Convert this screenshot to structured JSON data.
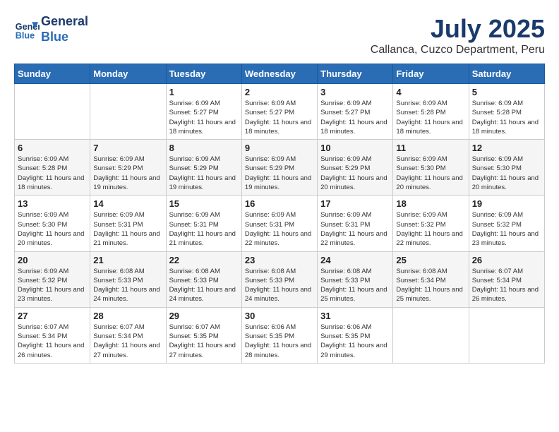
{
  "header": {
    "logo_line1": "General",
    "logo_line2": "Blue",
    "month": "July 2025",
    "location": "Callanca, Cuzco Department, Peru"
  },
  "weekdays": [
    "Sunday",
    "Monday",
    "Tuesday",
    "Wednesday",
    "Thursday",
    "Friday",
    "Saturday"
  ],
  "weeks": [
    [
      {
        "day": "",
        "info": ""
      },
      {
        "day": "",
        "info": ""
      },
      {
        "day": "1",
        "info": "Sunrise: 6:09 AM\nSunset: 5:27 PM\nDaylight: 11 hours and 18 minutes."
      },
      {
        "day": "2",
        "info": "Sunrise: 6:09 AM\nSunset: 5:27 PM\nDaylight: 11 hours and 18 minutes."
      },
      {
        "day": "3",
        "info": "Sunrise: 6:09 AM\nSunset: 5:27 PM\nDaylight: 11 hours and 18 minutes."
      },
      {
        "day": "4",
        "info": "Sunrise: 6:09 AM\nSunset: 5:28 PM\nDaylight: 11 hours and 18 minutes."
      },
      {
        "day": "5",
        "info": "Sunrise: 6:09 AM\nSunset: 5:28 PM\nDaylight: 11 hours and 18 minutes."
      }
    ],
    [
      {
        "day": "6",
        "info": "Sunrise: 6:09 AM\nSunset: 5:28 PM\nDaylight: 11 hours and 18 minutes."
      },
      {
        "day": "7",
        "info": "Sunrise: 6:09 AM\nSunset: 5:29 PM\nDaylight: 11 hours and 19 minutes."
      },
      {
        "day": "8",
        "info": "Sunrise: 6:09 AM\nSunset: 5:29 PM\nDaylight: 11 hours and 19 minutes."
      },
      {
        "day": "9",
        "info": "Sunrise: 6:09 AM\nSunset: 5:29 PM\nDaylight: 11 hours and 19 minutes."
      },
      {
        "day": "10",
        "info": "Sunrise: 6:09 AM\nSunset: 5:29 PM\nDaylight: 11 hours and 20 minutes."
      },
      {
        "day": "11",
        "info": "Sunrise: 6:09 AM\nSunset: 5:30 PM\nDaylight: 11 hours and 20 minutes."
      },
      {
        "day": "12",
        "info": "Sunrise: 6:09 AM\nSunset: 5:30 PM\nDaylight: 11 hours and 20 minutes."
      }
    ],
    [
      {
        "day": "13",
        "info": "Sunrise: 6:09 AM\nSunset: 5:30 PM\nDaylight: 11 hours and 20 minutes."
      },
      {
        "day": "14",
        "info": "Sunrise: 6:09 AM\nSunset: 5:31 PM\nDaylight: 11 hours and 21 minutes."
      },
      {
        "day": "15",
        "info": "Sunrise: 6:09 AM\nSunset: 5:31 PM\nDaylight: 11 hours and 21 minutes."
      },
      {
        "day": "16",
        "info": "Sunrise: 6:09 AM\nSunset: 5:31 PM\nDaylight: 11 hours and 22 minutes."
      },
      {
        "day": "17",
        "info": "Sunrise: 6:09 AM\nSunset: 5:31 PM\nDaylight: 11 hours and 22 minutes."
      },
      {
        "day": "18",
        "info": "Sunrise: 6:09 AM\nSunset: 5:32 PM\nDaylight: 11 hours and 22 minutes."
      },
      {
        "day": "19",
        "info": "Sunrise: 6:09 AM\nSunset: 5:32 PM\nDaylight: 11 hours and 23 minutes."
      }
    ],
    [
      {
        "day": "20",
        "info": "Sunrise: 6:09 AM\nSunset: 5:32 PM\nDaylight: 11 hours and 23 minutes."
      },
      {
        "day": "21",
        "info": "Sunrise: 6:08 AM\nSunset: 5:33 PM\nDaylight: 11 hours and 24 minutes."
      },
      {
        "day": "22",
        "info": "Sunrise: 6:08 AM\nSunset: 5:33 PM\nDaylight: 11 hours and 24 minutes."
      },
      {
        "day": "23",
        "info": "Sunrise: 6:08 AM\nSunset: 5:33 PM\nDaylight: 11 hours and 24 minutes."
      },
      {
        "day": "24",
        "info": "Sunrise: 6:08 AM\nSunset: 5:33 PM\nDaylight: 11 hours and 25 minutes."
      },
      {
        "day": "25",
        "info": "Sunrise: 6:08 AM\nSunset: 5:34 PM\nDaylight: 11 hours and 25 minutes."
      },
      {
        "day": "26",
        "info": "Sunrise: 6:07 AM\nSunset: 5:34 PM\nDaylight: 11 hours and 26 minutes."
      }
    ],
    [
      {
        "day": "27",
        "info": "Sunrise: 6:07 AM\nSunset: 5:34 PM\nDaylight: 11 hours and 26 minutes."
      },
      {
        "day": "28",
        "info": "Sunrise: 6:07 AM\nSunset: 5:34 PM\nDaylight: 11 hours and 27 minutes."
      },
      {
        "day": "29",
        "info": "Sunrise: 6:07 AM\nSunset: 5:35 PM\nDaylight: 11 hours and 27 minutes."
      },
      {
        "day": "30",
        "info": "Sunrise: 6:06 AM\nSunset: 5:35 PM\nDaylight: 11 hours and 28 minutes."
      },
      {
        "day": "31",
        "info": "Sunrise: 6:06 AM\nSunset: 5:35 PM\nDaylight: 11 hours and 29 minutes."
      },
      {
        "day": "",
        "info": ""
      },
      {
        "day": "",
        "info": ""
      }
    ]
  ]
}
